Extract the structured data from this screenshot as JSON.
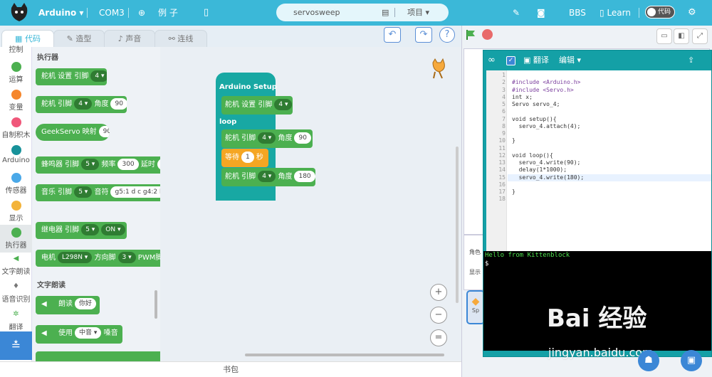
{
  "topbar": {
    "brand": "Arduino",
    "port": "COM3",
    "examples": "例 子",
    "project_name": "servosweep",
    "project_menu": "项目",
    "bbs": "BBS",
    "learn": "Learn",
    "code_toggle": "代码",
    "bg_color": "#3bb8d8"
  },
  "tabs": [
    {
      "label": "代码",
      "icon": "code-icon"
    },
    {
      "label": "造型",
      "icon": "brush-icon"
    },
    {
      "label": "声音",
      "icon": "speaker-icon"
    },
    {
      "label": "连线",
      "icon": "wire-icon"
    }
  ],
  "categories": [
    {
      "label": "控制",
      "color": "#f5a623"
    },
    {
      "label": "运算",
      "color": "#4cb050"
    },
    {
      "label": "变量",
      "color": "#f5862c"
    },
    {
      "label": "自制积木",
      "color": "#f0577a"
    },
    {
      "label": "Arduino",
      "color": "#18929a"
    },
    {
      "label": "传感器",
      "color": "#4aa8e8"
    },
    {
      "label": "显示",
      "color": "#f3b33a"
    },
    {
      "label": "执行器",
      "color": "#4cb050"
    },
    {
      "label": "文字朗读",
      "color": "#4cb050"
    },
    {
      "label": "语音识别",
      "color": "#888888"
    },
    {
      "label": "翻译",
      "color": "#4cb050"
    }
  ],
  "palette": {
    "section_actuator": "执行器",
    "section_tts": "文字朗读",
    "b1": {
      "t1": "舵机 设置 引脚",
      "v1": "4 ▾"
    },
    "b2": {
      "t1": "舵机 引脚",
      "v1": "4 ▾",
      "t2": "角度",
      "v2": "90"
    },
    "b3": {
      "t1": "GeekServo 映射",
      "v1": "90"
    },
    "b4": {
      "t1": "蜂鸣器 引脚",
      "v1": "5 ▾",
      "t2": "频率",
      "v2": "300",
      "t3": "延时",
      "v3": "5"
    },
    "b5": {
      "t1": "音乐 引脚",
      "v1": "5 ▾",
      "t2": "音符",
      "v2": "g5:1 d c g4:2 b:1"
    },
    "b6": {
      "t1": "继电器 引脚",
      "v1": "5 ▾",
      "v2": "ON ▾"
    },
    "b7": {
      "t1": "电机",
      "v1": "L298N ▾",
      "t2": "方向脚",
      "v2": "3 ▾",
      "t3": "PWM脚"
    },
    "b8": {
      "t1": "朗读",
      "v1": "你好"
    },
    "b9": {
      "t1": "使用",
      "v1": "中音 ▾",
      "t2": "嗓音"
    }
  },
  "workspace": {
    "hat_label": "Arduino Setup",
    "loop_label": "loop",
    "w1": {
      "t1": "舵机 设置 引脚",
      "v1": "4 ▾"
    },
    "w2": {
      "t1": "舵机 引脚",
      "v1": "4 ▾",
      "t2": "角度",
      "v2": "90"
    },
    "w3": {
      "t1": "等待",
      "v1": "1",
      "t2": "秒"
    },
    "w4": {
      "t1": "舵机 引脚",
      "v1": "4 ▾",
      "t2": "角度",
      "v2": "180"
    }
  },
  "bag_label": "书包",
  "stage": {
    "role_label": "角色",
    "show_label": "显示",
    "sprite_label": "Sp"
  },
  "editor": {
    "translate_label": "翻译",
    "edit_label": "编辑",
    "code_lines": [
      {
        "n": "1",
        "text": ""
      },
      {
        "n": "2",
        "text": "#include <Arduino.h>"
      },
      {
        "n": "3",
        "text": "#include <Servo.h>"
      },
      {
        "n": "4",
        "text": "int x;"
      },
      {
        "n": "5",
        "text": "Servo servo_4;"
      },
      {
        "n": "6",
        "text": ""
      },
      {
        "n": "7",
        "text": "void setup(){"
      },
      {
        "n": "8",
        "text": "  servo_4.attach(4);"
      },
      {
        "n": "9",
        "text": ""
      },
      {
        "n": "10",
        "text": "}"
      },
      {
        "n": "11",
        "text": ""
      },
      {
        "n": "12",
        "text": "void loop(){"
      },
      {
        "n": "13",
        "text": "  servo_4.write(90);"
      },
      {
        "n": "14",
        "text": "  delay(1*1000);"
      },
      {
        "n": "15",
        "text": "  servo_4.write(180);"
      },
      {
        "n": "16",
        "text": ""
      },
      {
        "n": "17",
        "text": "}"
      },
      {
        "n": "18",
        "text": ""
      }
    ],
    "terminal_line1": "Hello from Kittenblock",
    "terminal_line2": "$"
  },
  "watermark": {
    "brand": "Bai  经验",
    "url": "jingyan.baidu.com"
  }
}
